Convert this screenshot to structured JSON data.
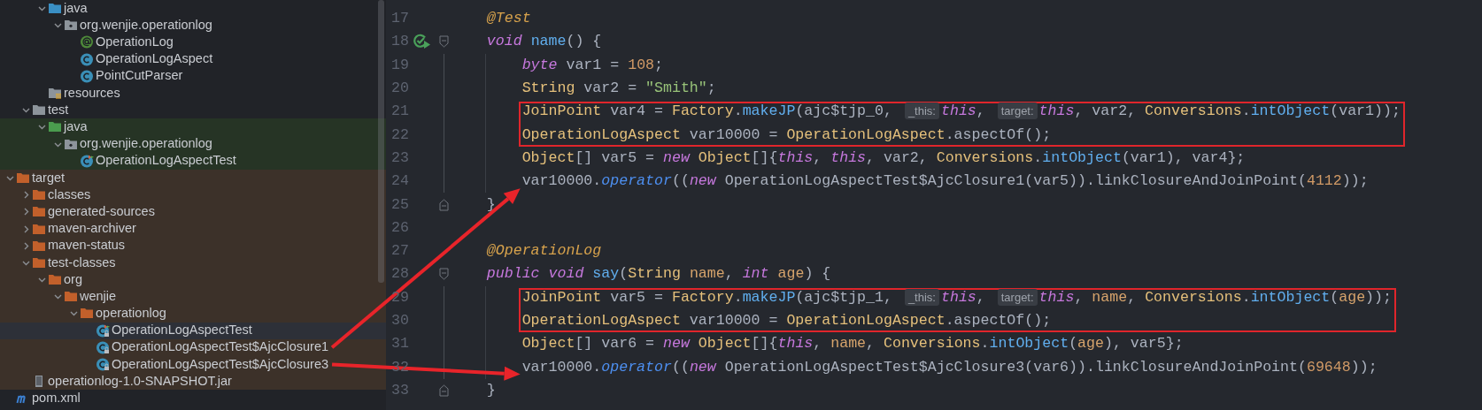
{
  "project_tree": {
    "items": [
      {
        "children": [
          {
            "children": [
              {
                "label": "java",
                "kind": "source-folder",
                "expanded": true,
                "selected": false,
                "children": [
                  {
                    "label": "org.wenjie.operationlog",
                    "kind": "package",
                    "expanded": true,
                    "selected": false,
                    "children": [
                      {
                        "label": "OperationLog",
                        "kind": "annotation",
                        "selected": false
                      },
                      {
                        "label": "OperationLogAspect",
                        "kind": "class",
                        "selected": false
                      },
                      {
                        "label": "PointCutParser",
                        "kind": "class",
                        "selected": false
                      }
                    ]
                  }
                ]
              },
              {
                "label": "resources",
                "kind": "resources-folder",
                "selected": false
              }
            ]
          },
          {
            "label": "test",
            "kind": "folder",
            "expanded": true,
            "selected": false,
            "children": [
              {
                "label": "java",
                "kind": "test-folder",
                "test_source": true,
                "expanded": true,
                "selected": false,
                "children": [
                  {
                    "label": "org.wenjie.operationlog",
                    "kind": "package",
                    "expanded": true,
                    "selected": false,
                    "children": [
                      {
                        "label": "OperationLogAspectTest",
                        "kind": "test-class",
                        "selected": false
                      }
                    ]
                  }
                ]
              }
            ]
          }
        ]
      },
      {
        "label": "target",
        "kind": "excluded-folder",
        "excluded": true,
        "expanded": true,
        "selected": false,
        "children": [
          {
            "label": "classes",
            "kind": "excluded-folder",
            "expanded": false,
            "selected": false
          },
          {
            "label": "generated-sources",
            "kind": "excluded-folder",
            "expanded": false,
            "selected": false
          },
          {
            "label": "maven-archiver",
            "kind": "excluded-folder",
            "expanded": false,
            "selected": false
          },
          {
            "label": "maven-status",
            "kind": "excluded-folder",
            "expanded": false,
            "selected": false
          },
          {
            "label": "test-classes",
            "kind": "excluded-folder",
            "expanded": true,
            "selected": false,
            "children": [
              {
                "label": "org",
                "kind": "excluded-folder",
                "expanded": true,
                "selected": false,
                "children": [
                  {
                    "label": "wenjie",
                    "kind": "excluded-folder",
                    "expanded": true,
                    "selected": false,
                    "children": [
                      {
                        "label": "operationlog",
                        "kind": "excluded-folder",
                        "expanded": true,
                        "selected": false,
                        "children": [
                          {
                            "label": "OperationLogAspectTest",
                            "kind": "compiled-test-class",
                            "selected": true
                          },
                          {
                            "label": "OperationLogAspectTest$AjcClosure1",
                            "kind": "compiled-class",
                            "selected": false,
                            "arrow_source": true
                          },
                          {
                            "label": "OperationLogAspectTest$AjcClosure3",
                            "kind": "compiled-class",
                            "selected": false,
                            "arrow_source": true
                          }
                        ]
                      }
                    ]
                  }
                ]
              }
            ]
          },
          {
            "label": "operationlog-1.0-SNAPSHOT.jar",
            "kind": "jar",
            "selected": false
          }
        ]
      },
      {
        "label": "pom.xml",
        "kind": "maven",
        "selected": false
      }
    ]
  },
  "editor": {
    "lines": [
      {
        "number": "17",
        "tokens": [
          {
            "text": "@Test",
            "kind": "annotation"
          }
        ]
      },
      {
        "number": "18",
        "run_icon": true,
        "fold_start": true,
        "tokens": [
          {
            "text": "void",
            "kind": "keyword"
          },
          {
            "text": " name",
            "kind": "method"
          },
          {
            "text": "() {",
            "kind": "plain"
          }
        ],
        "children": [
          {
            "number": "19",
            "tokens": [
              {
                "text": "byte",
                "kind": "keyword"
              },
              {
                "text": " var1 = ",
                "kind": "plain"
              },
              {
                "text": "108",
                "kind": "number"
              },
              {
                "text": ";",
                "kind": "plain"
              }
            ]
          },
          {
            "number": "20",
            "tokens": [
              {
                "text": "String",
                "kind": "type"
              },
              {
                "text": " var2 = ",
                "kind": "plain"
              },
              {
                "text": "\"Smith\"",
                "kind": "string"
              },
              {
                "text": ";",
                "kind": "plain"
              }
            ]
          },
          {
            "number": "21",
            "boxed": true,
            "tokens": [
              {
                "text": "JoinPoint",
                "kind": "type"
              },
              {
                "text": " var4 = ",
                "kind": "plain"
              },
              {
                "text": "Factory",
                "kind": "type"
              },
              {
                "text": ".",
                "kind": "plain"
              },
              {
                "text": "makeJP",
                "kind": "method"
              },
              {
                "text": "(ajc$tjp_0, ",
                "kind": "plain"
              },
              {
                "text": "_this:",
                "kind": "hint"
              },
              {
                "text": "this",
                "kind": "keyword"
              },
              {
                "text": ", ",
                "kind": "plain"
              },
              {
                "text": "target:",
                "kind": "hint"
              },
              {
                "text": "this",
                "kind": "keyword"
              },
              {
                "text": ", var2, ",
                "kind": "plain"
              },
              {
                "text": "Conversions",
                "kind": "type"
              },
              {
                "text": ".",
                "kind": "plain"
              },
              {
                "text": "intObject",
                "kind": "method"
              },
              {
                "text": "(var1));",
                "kind": "plain"
              }
            ]
          },
          {
            "number": "22",
            "boxed": true,
            "tokens": [
              {
                "text": "OperationLogAspect",
                "kind": "type"
              },
              {
                "text": " var10000 = ",
                "kind": "plain"
              },
              {
                "text": "OperationLogAspect",
                "kind": "type"
              },
              {
                "text": ".aspectOf();",
                "kind": "plain"
              }
            ]
          },
          {
            "number": "23",
            "tokens": [
              {
                "text": "Object",
                "kind": "type"
              },
              {
                "text": "[] var5 = ",
                "kind": "plain"
              },
              {
                "text": "new",
                "kind": "keyword"
              },
              {
                "text": " Object",
                "kind": "type"
              },
              {
                "text": "[]{",
                "kind": "plain"
              },
              {
                "text": "this",
                "kind": "keyword"
              },
              {
                "text": ", ",
                "kind": "plain"
              },
              {
                "text": "this",
                "kind": "keyword"
              },
              {
                "text": ", var2, ",
                "kind": "plain"
              },
              {
                "text": "Conversions",
                "kind": "type"
              },
              {
                "text": ".",
                "kind": "plain"
              },
              {
                "text": "intObject",
                "kind": "method"
              },
              {
                "text": "(var1), var4};",
                "kind": "plain"
              }
            ]
          },
          {
            "number": "24",
            "arrow_target": true,
            "tokens": [
              {
                "text": "var10000.",
                "kind": "plain"
              },
              {
                "text": "operator",
                "kind": "call"
              },
              {
                "text": "((",
                "kind": "plain"
              },
              {
                "text": "new",
                "kind": "keyword"
              },
              {
                "text": " OperationLogAspectTest$AjcClosure1(var5)).linkClosureAndJoinPoint(",
                "kind": "plain"
              },
              {
                "text": "4112",
                "kind": "number"
              },
              {
                "text": "));",
                "kind": "plain"
              }
            ]
          }
        ]
      },
      {
        "number": "25",
        "fold_end": true,
        "tokens": [
          {
            "text": "}",
            "kind": "plain"
          }
        ]
      },
      {
        "number": "26"
      },
      {
        "number": "27",
        "tokens": [
          {
            "text": "@OperationLog",
            "kind": "annotation"
          }
        ]
      },
      {
        "number": "28",
        "fold_start": true,
        "tokens": [
          {
            "text": "public",
            "kind": "keyword"
          },
          {
            "text": " void",
            "kind": "keyword"
          },
          {
            "text": " say",
            "kind": "method"
          },
          {
            "text": "(",
            "kind": "plain"
          },
          {
            "text": "String",
            "kind": "type"
          },
          {
            "text": " name",
            "kind": "param"
          },
          {
            "text": ", ",
            "kind": "plain"
          },
          {
            "text": "int",
            "kind": "keyword"
          },
          {
            "text": " age",
            "kind": "param"
          },
          {
            "text": ") {",
            "kind": "plain"
          }
        ],
        "children": [
          {
            "number": "29",
            "boxed": true,
            "tokens": [
              {
                "text": "JoinPoint",
                "kind": "type"
              },
              {
                "text": " var5 = ",
                "kind": "plain"
              },
              {
                "text": "Factory",
                "kind": "type"
              },
              {
                "text": ".",
                "kind": "plain"
              },
              {
                "text": "makeJP",
                "kind": "method"
              },
              {
                "text": "(ajc$tjp_1, ",
                "kind": "plain"
              },
              {
                "text": "_this:",
                "kind": "hint"
              },
              {
                "text": "this",
                "kind": "keyword"
              },
              {
                "text": ", ",
                "kind": "plain"
              },
              {
                "text": "target:",
                "kind": "hint"
              },
              {
                "text": "this",
                "kind": "keyword"
              },
              {
                "text": ", ",
                "kind": "plain"
              },
              {
                "text": "name",
                "kind": "param"
              },
              {
                "text": ", ",
                "kind": "plain"
              },
              {
                "text": "Conversions",
                "kind": "type"
              },
              {
                "text": ".",
                "kind": "plain"
              },
              {
                "text": "intObject",
                "kind": "method"
              },
              {
                "text": "(",
                "kind": "plain"
              },
              {
                "text": "age",
                "kind": "param"
              },
              {
                "text": "));",
                "kind": "plain"
              }
            ]
          },
          {
            "number": "30",
            "boxed": true,
            "tokens": [
              {
                "text": "OperationLogAspect",
                "kind": "type"
              },
              {
                "text": " var10000 = ",
                "kind": "plain"
              },
              {
                "text": "OperationLogAspect",
                "kind": "type"
              },
              {
                "text": ".aspectOf();",
                "kind": "plain"
              }
            ]
          },
          {
            "number": "31",
            "tokens": [
              {
                "text": "Object",
                "kind": "type"
              },
              {
                "text": "[] var6 = ",
                "kind": "plain"
              },
              {
                "text": "new",
                "kind": "keyword"
              },
              {
                "text": " Object",
                "kind": "type"
              },
              {
                "text": "[]{",
                "kind": "plain"
              },
              {
                "text": "this",
                "kind": "keyword"
              },
              {
                "text": ", ",
                "kind": "plain"
              },
              {
                "text": "name",
                "kind": "param"
              },
              {
                "text": ", ",
                "kind": "plain"
              },
              {
                "text": "Conversions",
                "kind": "type"
              },
              {
                "text": ".",
                "kind": "plain"
              },
              {
                "text": "intObject",
                "kind": "method"
              },
              {
                "text": "(",
                "kind": "plain"
              },
              {
                "text": "age",
                "kind": "param"
              },
              {
                "text": "), var5};",
                "kind": "plain"
              }
            ]
          },
          {
            "number": "32",
            "arrow_target": true,
            "tokens": [
              {
                "text": "var10000.",
                "kind": "plain"
              },
              {
                "text": "operator",
                "kind": "call"
              },
              {
                "text": "((",
                "kind": "plain"
              },
              {
                "text": "new",
                "kind": "keyword"
              },
              {
                "text": " OperationLogAspectTest$AjcClosure3(var6)).linkClosureAndJoinPoint(",
                "kind": "plain"
              },
              {
                "text": "69648",
                "kind": "number"
              },
              {
                "text": "));",
                "kind": "plain"
              }
            ]
          }
        ]
      },
      {
        "number": "33",
        "fold_end": true,
        "tokens": [
          {
            "text": "}",
            "kind": "plain"
          }
        ]
      }
    ]
  }
}
